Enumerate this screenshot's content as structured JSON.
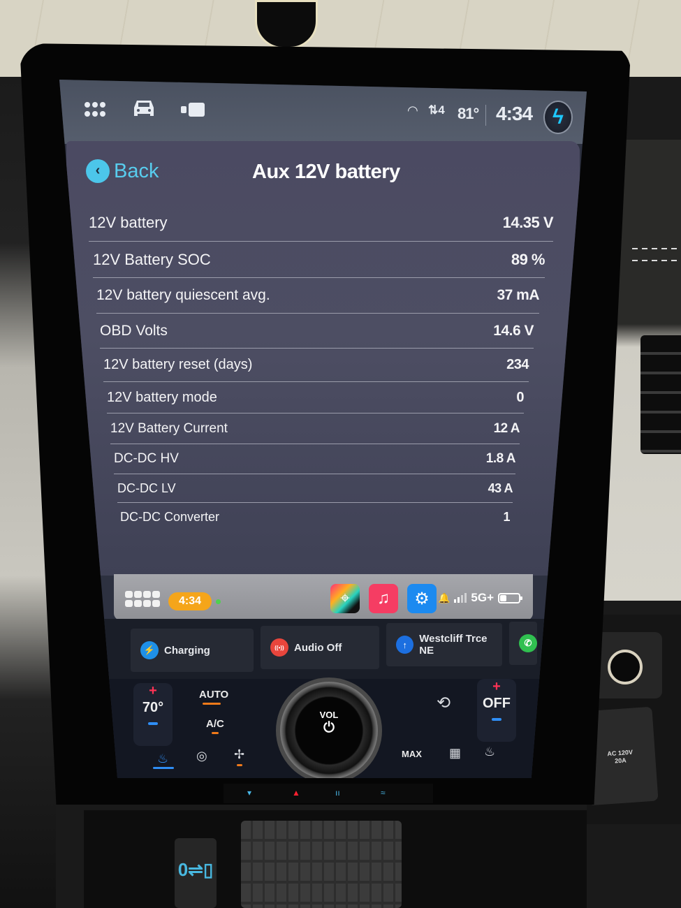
{
  "status_bar": {
    "icons": [
      "apps-grid-icon",
      "vehicle-icon",
      "camera-icon"
    ],
    "wifi_icon": "wifi-icon",
    "data_icon": "data-transfer-icon",
    "data_glyph": "⇅4",
    "outside_temp": "81°",
    "time": "4:34",
    "profile_icon": "lightning-bolt-icon",
    "profile_glyph": "ϟ"
  },
  "page": {
    "back_label": "Back",
    "back_glyph": "‹",
    "title": "Aux 12V battery"
  },
  "rows": [
    {
      "label": "12V battery",
      "value": "14.35 V"
    },
    {
      "label": "12V Battery SOC",
      "value": "89 %"
    },
    {
      "label": "12V battery quiescent avg.",
      "value": "37 mA"
    },
    {
      "label": "OBD Volts",
      "value": "14.6 V"
    },
    {
      "label": "12V battery reset (days)",
      "value": "234"
    },
    {
      "label": "12V battery mode",
      "value": "0"
    },
    {
      "label": "12V Battery Current",
      "value": "12 A"
    },
    {
      "label": "DC-DC HV",
      "value": "1.8 A"
    },
    {
      "label": "DC-DC LV",
      "value": "43 A"
    },
    {
      "label": "DC-DC Converter",
      "value": "1"
    }
  ],
  "dock": {
    "time": "4:34",
    "apps": [
      {
        "name": "maps-app",
        "glyph": "⌖"
      },
      {
        "name": "music-app",
        "glyph": "♫"
      },
      {
        "name": "obd-engine-app",
        "glyph": "⚙"
      }
    ],
    "notification_icon": "bell-icon",
    "notification_glyph": "🔔",
    "network": "5G+",
    "signal_bars": 4,
    "signal_active": 2,
    "battery_level_percent": 40,
    "colors": {
      "time_pill": "#f5a51a",
      "live_dot": "#4fd14f"
    }
  },
  "widgets": [
    {
      "label": "Charging",
      "icon": "ev-charging-icon",
      "glyph": "⚡",
      "color": "#1e90e8"
    },
    {
      "label": "Audio Off",
      "icon": "radio-broadcast-icon",
      "glyph": "((•))",
      "color": "#e8453c"
    },
    {
      "label": "Westcliff Trce NE",
      "icon": "navigation-arrow-icon",
      "glyph": "↑",
      "color": "#1c6fe0"
    },
    {
      "label": "",
      "icon": "phone-icon",
      "glyph": "✆",
      "color": "#30c050"
    }
  ],
  "climate": {
    "driver_temp": "70°",
    "passenger_temp": "OFF",
    "plus": "+",
    "auto_label": "AUTO",
    "ac_label": "A/C",
    "knob_label": "VOL",
    "power_glyph": "⏻",
    "max_defrost_label": "MAX",
    "icons": {
      "recirc": "air-recirculation-icon",
      "seat_heat": "heated-seat-icon",
      "steering_heat": "heated-steering-icon",
      "fan": "fan-icon",
      "defrost_front": "front-defrost-icon",
      "defrost_rear": "rear-defrost-icon",
      "seat_right": "passenger-seat-icon"
    },
    "colors": {
      "active": "#f07a1a",
      "cool": "#2f8ef5",
      "heat": "#ff3355"
    }
  },
  "hardware": {
    "ac_outlet_label": "AC 120V\n20A",
    "usb_glyph": "0⇌▯"
  }
}
